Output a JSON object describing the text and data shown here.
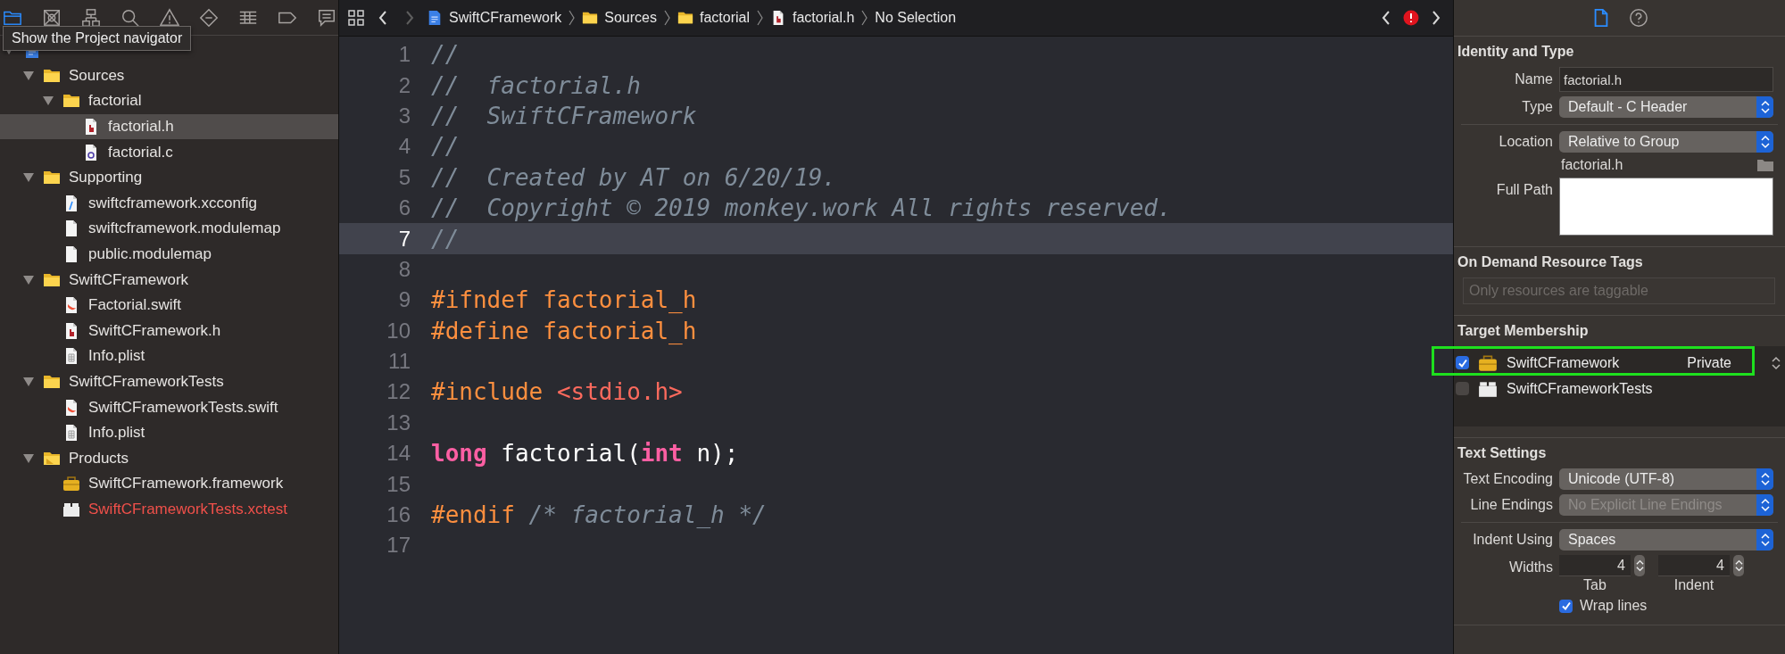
{
  "navigator": {
    "toolbar": [
      {
        "kind": "folder",
        "selected": true
      },
      {
        "kind": "boxx",
        "selected": false
      },
      {
        "kind": "hierarchy",
        "selected": false
      },
      {
        "kind": "search",
        "selected": false
      },
      {
        "kind": "warning",
        "selected": false
      },
      {
        "kind": "diamond",
        "selected": false
      },
      {
        "kind": "list",
        "selected": false
      },
      {
        "kind": "tag",
        "selected": false
      },
      {
        "kind": "comment",
        "selected": false
      }
    ],
    "tooltip": "Show the Project navigator",
    "tree": [
      {
        "kind": "project",
        "expanded": true,
        "selected": false,
        "children": [
          {
            "label": "Sources",
            "kind": "folder",
            "expanded": true,
            "selected": false,
            "children": [
              {
                "label": "factorial",
                "kind": "folder",
                "expanded": true,
                "selected": false,
                "children": [
                  {
                    "label": "factorial.h",
                    "kind": "header",
                    "selected": true,
                    "missing": false
                  },
                  {
                    "label": "factorial.c",
                    "kind": "source",
                    "selected": false,
                    "missing": false
                  }
                ]
              }
            ]
          },
          {
            "label": "Supporting",
            "kind": "folder",
            "expanded": true,
            "selected": false,
            "children": [
              {
                "label": "swiftcframework.xcconfig",
                "kind": "config",
                "selected": false,
                "missing": false
              },
              {
                "label": "swiftcframework.modulemap",
                "kind": "blank",
                "selected": false,
                "missing": false
              },
              {
                "label": "public.modulemap",
                "kind": "blank",
                "selected": false,
                "missing": false
              }
            ]
          },
          {
            "label": "SwiftCFramework",
            "kind": "folder",
            "expanded": true,
            "selected": false,
            "children": [
              {
                "label": "Factorial.swift",
                "kind": "swift",
                "selected": false,
                "missing": false
              },
              {
                "label": "SwiftCFramework.h",
                "kind": "header",
                "selected": false,
                "missing": false
              },
              {
                "label": "Info.plist",
                "kind": "plist",
                "selected": false,
                "missing": false
              }
            ]
          },
          {
            "label": "SwiftCFrameworkTests",
            "kind": "folder",
            "expanded": true,
            "selected": false,
            "children": [
              {
                "label": "SwiftCFrameworkTests.swift",
                "kind": "swift",
                "selected": false,
                "missing": false
              },
              {
                "label": "Info.plist",
                "kind": "plist",
                "selected": false,
                "missing": false
              }
            ]
          },
          {
            "label": "Products",
            "kind": "products",
            "expanded": true,
            "selected": false,
            "children": [
              {
                "label": "SwiftCFramework.framework",
                "kind": "framework",
                "selected": false,
                "missing": false
              },
              {
                "label": "SwiftCFrameworkTests.xctest",
                "kind": "bundle",
                "selected": false,
                "missing": true
              }
            ]
          }
        ]
      }
    ]
  },
  "editor": {
    "crumbs": [
      {
        "kind": "project",
        "label": "SwiftCFramework"
      },
      {
        "kind": "folder",
        "label": "Sources"
      },
      {
        "kind": "folder",
        "label": "factorial"
      },
      {
        "kind": "header",
        "label": "factorial.h"
      },
      {
        "label": "No Selection"
      }
    ],
    "lines": [
      {
        "number": "1",
        "current": false,
        "tokens": [
          {
            "kind": "comment",
            "text": "//"
          }
        ]
      },
      {
        "number": "2",
        "current": false,
        "tokens": [
          {
            "kind": "comment",
            "text": "//  factorial.h"
          }
        ]
      },
      {
        "number": "3",
        "current": false,
        "tokens": [
          {
            "kind": "comment",
            "text": "//  SwiftCFramework"
          }
        ]
      },
      {
        "number": "4",
        "current": false,
        "tokens": [
          {
            "kind": "comment",
            "text": "//"
          }
        ]
      },
      {
        "number": "5",
        "current": false,
        "tokens": [
          {
            "kind": "comment",
            "text": "//  Created by AT on 6/20/19."
          }
        ]
      },
      {
        "number": "6",
        "current": false,
        "tokens": [
          {
            "kind": "comment",
            "text": "//  Copyright © 2019 monkey.work All rights reserved."
          }
        ]
      },
      {
        "number": "7",
        "current": true,
        "tokens": [
          {
            "kind": "comment",
            "text": "//"
          }
        ]
      },
      {
        "number": "8",
        "current": false
      },
      {
        "number": "9",
        "current": false,
        "tokens": [
          {
            "kind": "preproc",
            "text": "#ifndef factorial_h"
          }
        ]
      },
      {
        "number": "10",
        "current": false,
        "tokens": [
          {
            "kind": "preproc",
            "text": "#define factorial_h"
          }
        ]
      },
      {
        "number": "11",
        "current": false
      },
      {
        "number": "12",
        "current": false,
        "tokens": [
          {
            "kind": "preproc",
            "text": "#include "
          },
          {
            "kind": "string",
            "text": "<stdio.h>"
          }
        ]
      },
      {
        "number": "13",
        "current": false
      },
      {
        "number": "14",
        "current": false,
        "tokens": [
          {
            "kind": "keyword",
            "text": "long"
          },
          {
            "kind": "plain",
            "text": " factorial("
          },
          {
            "kind": "keyword",
            "text": "int"
          },
          {
            "kind": "plain",
            "text": " n);"
          }
        ]
      },
      {
        "number": "15",
        "current": false
      },
      {
        "number": "16",
        "current": false,
        "tokens": [
          {
            "kind": "preproc",
            "text": "#endif "
          },
          {
            "kind": "comment",
            "text": "/* factorial_h */"
          }
        ]
      },
      {
        "number": "17",
        "current": false
      }
    ]
  },
  "inspector": {
    "tabs": [
      {
        "kind": "file",
        "selected": true
      },
      {
        "kind": "help",
        "selected": false
      }
    ],
    "identity": {
      "title": "Identity and Type",
      "groups": [
        [
          {
            "kind": "text",
            "label": "Name",
            "value": "factorial.h"
          },
          {
            "kind": "popup",
            "label": "Type",
            "value": "Default - C Header",
            "disabled": false
          }
        ],
        [
          {
            "kind": "popup",
            "label": "Location",
            "value": "Relative to Group",
            "disabled": false
          },
          {
            "kind": "path",
            "value": "factorial.h"
          },
          {
            "kind": "area",
            "label": "Full Path"
          }
        ]
      ]
    },
    "tags": {
      "title": "On Demand Resource Tags",
      "placeholder": "Only resources are taggable"
    },
    "membership": {
      "title": "Target Membership",
      "targets": [
        {
          "name": "SwiftCFramework",
          "kind": "framework",
          "checked": true,
          "visibility": "Private",
          "highlighted": true
        },
        {
          "name": "SwiftCFrameworkTests",
          "kind": "bundle",
          "checked": false,
          "highlighted": false
        }
      ]
    },
    "text_settings": {
      "title": "Text Settings",
      "groups": [
        [
          {
            "kind": "popup",
            "label": "Text Encoding",
            "value": "Unicode (UTF-8)",
            "disabled": false
          },
          {
            "kind": "popup",
            "label": "Line Endings",
            "value": "No Explicit Line Endings",
            "disabled": true
          }
        ],
        [
          {
            "kind": "popup",
            "label": "Indent Using",
            "value": "Spaces",
            "disabled": false
          },
          {
            "kind": "widths",
            "label": "Widths",
            "fields": [
              {
                "value": "4",
                "caption": "Tab"
              },
              {
                "value": "4",
                "caption": "Indent"
              }
            ]
          },
          {
            "kind": "checkbox",
            "label": "Wrap lines",
            "checked": true
          }
        ]
      ]
    }
  }
}
